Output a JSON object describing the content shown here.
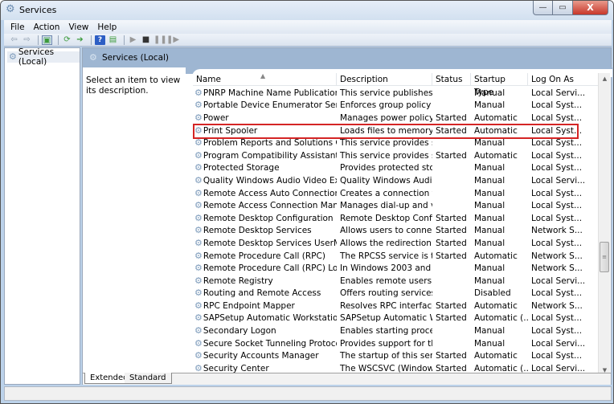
{
  "window": {
    "title": "Services",
    "title_icon": "services-gear-icon",
    "controls": {
      "minimize": "—",
      "maximize": "▭",
      "close": "X"
    }
  },
  "menubar": {
    "items": [
      "File",
      "Action",
      "View",
      "Help"
    ]
  },
  "toolbar": {
    "icons": [
      "back-icon",
      "forward-icon",
      "show-hide-console-tree-icon",
      "refresh-icon",
      "export-list-icon",
      "help-icon",
      "properties-icon",
      "start-service-icon",
      "stop-service-icon",
      "pause-service-icon",
      "restart-service-icon"
    ]
  },
  "tree": {
    "items": [
      {
        "label": "Services (Local)"
      }
    ]
  },
  "pane": {
    "header": "Services (Local)",
    "description_prompt": "Select an item to view its description."
  },
  "table": {
    "columns": [
      "Name",
      "Description",
      "Status",
      "Startup Type",
      "Log On As"
    ],
    "sort_column": "Name",
    "sort_direction": "ascending",
    "selected_row": "Print Spooler",
    "rows": [
      {
        "name": "PNRP Machine Name Publication Se...",
        "description": "This service publishes a ...",
        "status": "",
        "startup": "Manual",
        "logon": "Local Servi..."
      },
      {
        "name": "Portable Device Enumerator Service",
        "description": "Enforces group policy fo...",
        "status": "",
        "startup": "Manual",
        "logon": "Local Syst..."
      },
      {
        "name": "Power",
        "description": "Manages power policy a...",
        "status": "Started",
        "startup": "Automatic",
        "logon": "Local Syst..."
      },
      {
        "name": "Print Spooler",
        "description": "Loads files to memory f...",
        "status": "Started",
        "startup": "Automatic",
        "logon": "Local Syst..."
      },
      {
        "name": "Problem Reports and Solutions Cont...",
        "description": "This service provides su...",
        "status": "",
        "startup": "Manual",
        "logon": "Local Syst..."
      },
      {
        "name": "Program Compatibility Assistant Ser...",
        "description": "This service provides su...",
        "status": "Started",
        "startup": "Automatic",
        "logon": "Local Syst..."
      },
      {
        "name": "Protected Storage",
        "description": "Provides protected stora...",
        "status": "",
        "startup": "Manual",
        "logon": "Local Syst..."
      },
      {
        "name": "Quality Windows Audio Video Exper...",
        "description": "Quality Windows Audio ...",
        "status": "",
        "startup": "Manual",
        "logon": "Local Servi..."
      },
      {
        "name": "Remote Access Auto Connection Ma...",
        "description": "Creates a connection to ...",
        "status": "",
        "startup": "Manual",
        "logon": "Local Syst..."
      },
      {
        "name": "Remote Access Connection Manager",
        "description": "Manages dial-up and vir...",
        "status": "",
        "startup": "Manual",
        "logon": "Local Syst..."
      },
      {
        "name": "Remote Desktop Configuration",
        "description": "Remote Desktop Config...",
        "status": "Started",
        "startup": "Manual",
        "logon": "Local Syst..."
      },
      {
        "name": "Remote Desktop Services",
        "description": "Allows users to connect ...",
        "status": "Started",
        "startup": "Manual",
        "logon": "Network S..."
      },
      {
        "name": "Remote Desktop Services UserMode...",
        "description": "Allows the redirection o...",
        "status": "Started",
        "startup": "Manual",
        "logon": "Local Syst..."
      },
      {
        "name": "Remote Procedure Call (RPC)",
        "description": "The RPCSS service is the ...",
        "status": "Started",
        "startup": "Automatic",
        "logon": "Network S..."
      },
      {
        "name": "Remote Procedure Call (RPC) Locator",
        "description": "In Windows 2003 and ea...",
        "status": "",
        "startup": "Manual",
        "logon": "Network S..."
      },
      {
        "name": "Remote Registry",
        "description": "Enables remote users to ...",
        "status": "",
        "startup": "Manual",
        "logon": "Local Servi..."
      },
      {
        "name": "Routing and Remote Access",
        "description": "Offers routing services t...",
        "status": "",
        "startup": "Disabled",
        "logon": "Local Syst..."
      },
      {
        "name": "RPC Endpoint Mapper",
        "description": "Resolves RPC interfaces ...",
        "status": "Started",
        "startup": "Automatic",
        "logon": "Network S..."
      },
      {
        "name": "SAPSetup Automatic Workstation U...",
        "description": "SAPSetup Automatic W...",
        "status": "Started",
        "startup": "Automatic (...",
        "logon": "Local Syst..."
      },
      {
        "name": "Secondary Logon",
        "description": "Enables starting process...",
        "status": "",
        "startup": "Manual",
        "logon": "Local Syst..."
      },
      {
        "name": "Secure Socket Tunneling Protocol Se...",
        "description": "Provides support for the...",
        "status": "",
        "startup": "Manual",
        "logon": "Local Servi..."
      },
      {
        "name": "Security Accounts Manager",
        "description": "The startup of this servic...",
        "status": "Started",
        "startup": "Automatic",
        "logon": "Local Syst..."
      },
      {
        "name": "Security Center",
        "description": "The WSCSVC (Windows ...",
        "status": "Started",
        "startup": "Automatic (...",
        "logon": "Local Servi..."
      }
    ]
  },
  "tabs": [
    {
      "label": "Extended",
      "active": true
    },
    {
      "label": "Standard",
      "active": false
    }
  ],
  "colors": {
    "highlight_border": "#d42525",
    "pane_header": "#9eb6d2"
  }
}
